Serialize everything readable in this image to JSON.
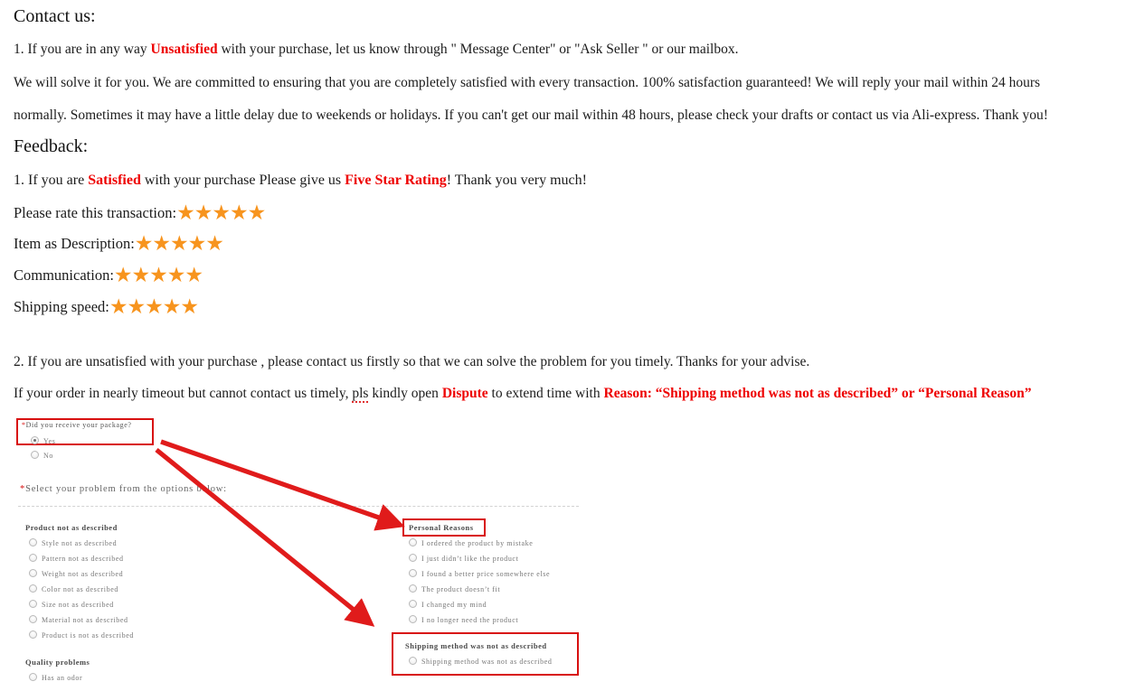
{
  "document": {
    "contact_heading": "Contact us:",
    "contact_item_1_pre": "1.  If you are in any way ",
    "contact_item_1_red": "Unsatisfied",
    "contact_item_1_post": " with your purchase, let us know through \" Message Center\" or \"Ask Seller \" or our mailbox.",
    "contact_para_2": "We will solve it for you. We are committed to ensuring that you are completely satisfied with every transaction. 100% satisfaction guaranteed!    We will reply your mail within 24 hours",
    "contact_para_3": "normally. Sometimes it may have a little delay due to weekends or holidays. If you can't get our mail within 48 hours, please check your drafts or contact us via Ali-express. Thank you!",
    "feedback_heading": "Feedback:",
    "feedback_item_1_pre": "1.  If you are ",
    "feedback_item_1_red1": "Satisfied",
    "feedback_item_1_mid": " with your purchase Please give us ",
    "feedback_item_1_red2": "Five Star Rating",
    "feedback_item_1_post": "! Thank you very much!",
    "feedback_item_2": "2.  If you are unsatisfied with your purchase , please contact us firstly so that we can solve the problem for you timely. Thanks for your advise.",
    "dispute_pre": "If your order in nearly timeout but cannot contact us timely, ",
    "dispute_spell": "pls",
    "dispute_mid": " kindly open ",
    "dispute_word": "Dispute",
    "dispute_mid2": " to extend time with ",
    "dispute_reason": "Reason: “Shipping method was not as described” or “Personal Reason”"
  },
  "ratings": {
    "star_glyph": "★",
    "star_color": "#f7941e",
    "rows": [
      {
        "label": "Please rate this transaction:",
        "stars": 5
      },
      {
        "label": "Item as Description:",
        "stars": 5
      },
      {
        "label": "Communication:",
        "stars": 5
      },
      {
        "label": "Shipping speed:",
        "stars": 5
      }
    ]
  },
  "form": {
    "receive_question": "Did you receive your package?",
    "required_mark": "*",
    "receive_options": [
      {
        "label": "Yes",
        "selected": true
      },
      {
        "label": "No",
        "selected": false
      }
    ],
    "select_problem_label": "Select your problem from the options below:",
    "groups": [
      {
        "title": "Product not as described",
        "highlighted": false,
        "options": [
          "Style not as described",
          "Pattern not as described",
          "Weight not as described",
          "Color not as described",
          "Size not as described",
          "Material not as described",
          "Product is not as described"
        ]
      },
      {
        "title": "Quality problems",
        "highlighted": false,
        "options": [
          "Has an odor"
        ]
      },
      {
        "title": "Personal Reasons",
        "highlighted": true,
        "options": [
          "I ordered the product by mistake",
          "I just didn’t like the product",
          "I found a better price somewhere else",
          "The product doesn’t fit",
          "I changed my mind",
          "I no longer need the product"
        ]
      },
      {
        "title": "Shipping method was not as described",
        "highlighted": true,
        "options": [
          "Shipping method was not as described"
        ]
      }
    ],
    "annotation_color": "#d81010",
    "arrow_count": 2
  }
}
